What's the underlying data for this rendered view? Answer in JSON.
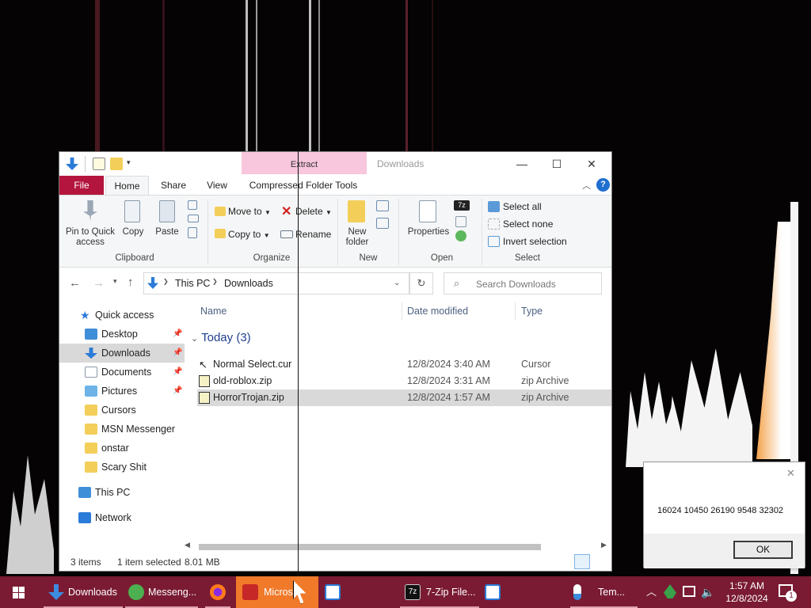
{
  "window": {
    "title": "Downloads",
    "extract_tab": "Extract",
    "controls": {
      "minimize": "—",
      "maximize": "☐",
      "close": "✕"
    }
  },
  "tabs": [
    {
      "label": "File"
    },
    {
      "label": "Home"
    },
    {
      "label": "Share"
    },
    {
      "label": "View"
    },
    {
      "label": "Compressed Folder Tools"
    }
  ],
  "ribbon": {
    "pin_label": "Pin to Quick access",
    "copy_label": "Copy",
    "paste_label": "Paste",
    "clipboard_group": "Clipboard",
    "move_to": "Move to",
    "copy_to": "Copy to",
    "delete": "Delete",
    "rename": "Rename",
    "organize_group": "Organize",
    "new_folder": "New folder",
    "new_group": "New",
    "properties": "Properties",
    "open_group": "Open",
    "select_all": "Select all",
    "select_none": "Select none",
    "invert_selection": "Invert selection",
    "select_group": "Select"
  },
  "address": {
    "crumbs": [
      "This PC",
      "Downloads"
    ],
    "search_placeholder": "Search Downloads"
  },
  "nav": {
    "quick_access": "Quick access",
    "items": [
      {
        "label": "Desktop",
        "pinned": true
      },
      {
        "label": "Downloads",
        "pinned": true,
        "selected": true
      },
      {
        "label": "Documents",
        "pinned": true
      },
      {
        "label": "Pictures",
        "pinned": true
      },
      {
        "label": "Cursors"
      },
      {
        "label": "MSN Messenger"
      },
      {
        "label": "onstar"
      },
      {
        "label": "Scary Shit"
      }
    ],
    "this_pc": "This PC",
    "network": "Network"
  },
  "files": {
    "columns": [
      "Name",
      "Date modified",
      "Type"
    ],
    "group": "Today (3)",
    "rows": [
      {
        "name": "Normal Select.cur",
        "date": "12/8/2024 3:40 AM",
        "type": "Cursor"
      },
      {
        "name": "old-roblox.zip",
        "date": "12/8/2024 3:31 AM",
        "type": "zip Archive"
      },
      {
        "name": "HorrorTrojan.zip",
        "date": "12/8/2024 1:57 AM",
        "type": "zip Archive",
        "selected": true
      }
    ]
  },
  "status": {
    "items": "3 items",
    "selected": "1 item selected",
    "size": "8.01 MB"
  },
  "dialog": {
    "message": "16024 10450 26190 9548 32302",
    "ok": "OK",
    "close": "✕"
  },
  "taskbar": {
    "items": [
      {
        "label": "Downloads"
      },
      {
        "label": "Messeng..."
      },
      {
        "label": ""
      },
      {
        "label": "Micros"
      },
      {
        "label": ""
      },
      {
        "label": "7-Zip File..."
      },
      {
        "label": ""
      },
      {
        "label": "Tem..."
      }
    ],
    "time": "1:57 AM",
    "date": "12/8/2024",
    "notification_count": "1"
  },
  "colors": {
    "taskbar": "#7a1b33",
    "file_tab": "#b4153e",
    "extract_tab": "#f8c6dd",
    "active_task": "#f07a2a"
  }
}
